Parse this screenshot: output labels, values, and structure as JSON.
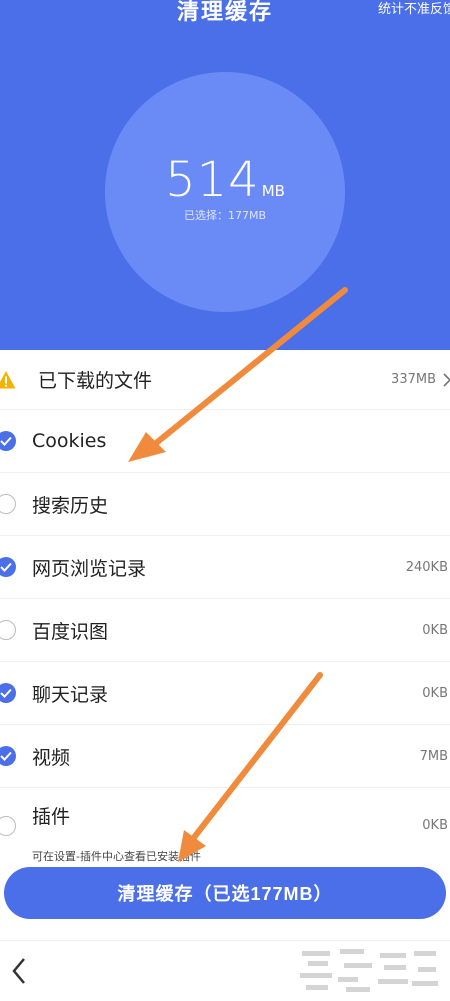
{
  "header": {
    "title": "清理缓存",
    "right_text": "统计不准反馈",
    "total_size": "514",
    "total_unit": "MB",
    "selected_text": "已选择：177MB"
  },
  "downloads": {
    "label": "已下载的文件",
    "value": "337MB",
    "icon": "warning-icon",
    "chevron": "chevron-right-icon"
  },
  "items": [
    {
      "label": "Cookies",
      "checked": true,
      "value": ""
    },
    {
      "label": "搜索历史",
      "checked": false,
      "value": ""
    },
    {
      "label": "网页浏览记录",
      "checked": true,
      "value": "240KB"
    },
    {
      "label": "百度识图",
      "checked": false,
      "value": "0KB"
    },
    {
      "label": "聊天记录",
      "checked": true,
      "value": "0KB"
    },
    {
      "label": "视频",
      "checked": true,
      "value": "7MB"
    },
    {
      "label": "插件",
      "checked": false,
      "value": "0KB"
    }
  ],
  "plugin_note": "可在设置-插件中心查看已安装插件",
  "action_button": "清理缓存（已选177MB）",
  "nav": {
    "back_icon": "chevron-left-icon"
  },
  "colors": {
    "primary": "#4a6fe8",
    "circle": "#6a8bf6",
    "warning": "#f5b301",
    "arrow": "#f08a3c"
  }
}
